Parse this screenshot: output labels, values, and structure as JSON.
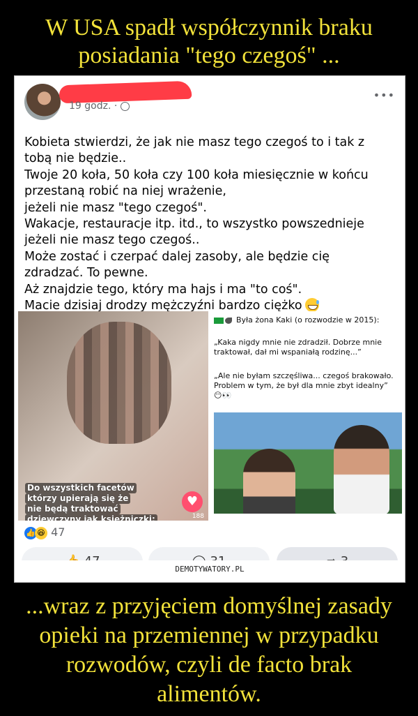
{
  "top_title": {
    "line1": "W USA spadł współczynnik braku",
    "line2": "posiadania \"tego czegoś\" ..."
  },
  "post": {
    "meta_time": "19 godz. ·",
    "text_lines": [
      "Kobieta stwierdzi, że jak nie masz tego czegoś to i tak z",
      "tobą nie będzie..",
      "Twoje 20 koła, 50 koła czy 100 koła miesięcznie w końcu",
      "przestaną robić na niej wrażenie,",
      "jeżeli nie masz \"tego czegoś\".",
      "Wakacje, restauracje itp. itd., to wszystko powszednieje",
      "jeżeli nie masz tego czegoś..",
      "Może zostać i czerpać dalej zasoby, ale będzie cię",
      "zdradzać. To pewne.",
      "Aż znajdzie tego, który ma hajs i ma \"to coś\".",
      "Macie dzisiaj drodzy mężczyźni bardzo ciężko"
    ],
    "image_caption_lines": [
      "Do wszystkich facetów",
      "którzy upierają się że",
      "nie będą traktować",
      "dziewczyny jak księżniczki:"
    ],
    "image_like_count": "188",
    "right_panel": {
      "title": "Była żona Kaki (o rozwodzie w 2015):",
      "quote1": "„Kaka nigdy mnie nie zdradził. Dobrze mnie traktował, dał mi wspaniałą rodzinę...”",
      "quote2": "„Ale nie byłam szczęśliwa... czegoś brakowało. Problem w tym, że był dla mnie zbyt idealny” 😶👀"
    },
    "reactions_count": "47",
    "actions": {
      "like_count": "47",
      "comments_count": "31",
      "shares_count": "3"
    },
    "watermark": "DEMOTYWATORY.PL"
  },
  "bottom_title": {
    "line1": "...wraz z przyjęciem domyślnej zasady",
    "line2": "opieki na przemiennej w przypadku",
    "line3": "rozwodów, czyli de facto brak",
    "line4": "alimentów."
  },
  "colors": {
    "title_yellow": "#f2e23a",
    "facebook_blue": "#1877f2",
    "redaction_red": "#ff3c46"
  }
}
